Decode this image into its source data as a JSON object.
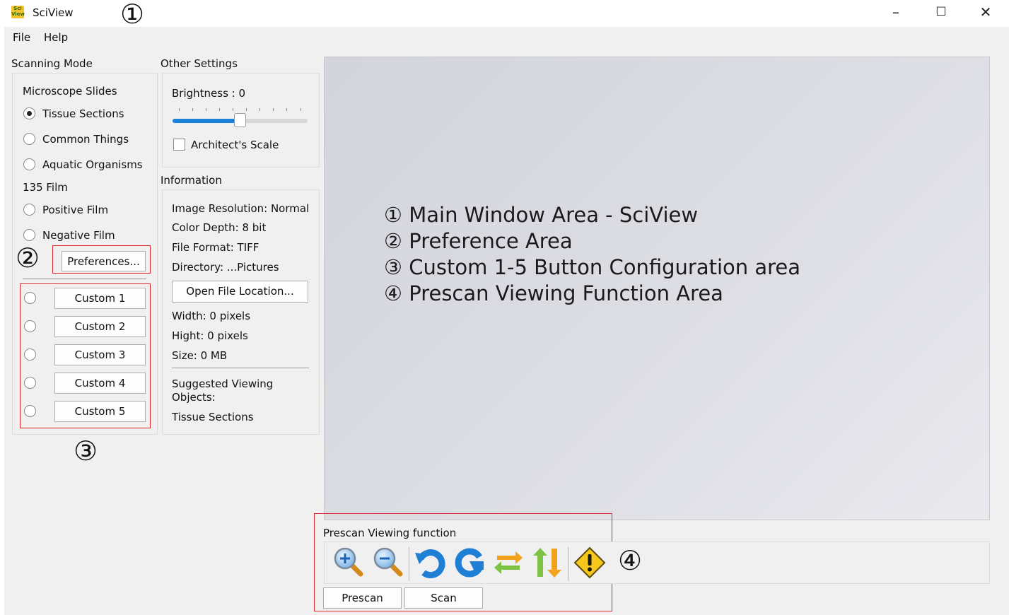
{
  "window": {
    "title": "SciView",
    "icon_text": "Sci\nView",
    "minimize": "–",
    "maximize": "☐",
    "close": "✕"
  },
  "menu": {
    "file": "File",
    "help": "Help"
  },
  "markers": {
    "m1": "①",
    "m2": "②",
    "m3": "③",
    "m4": "④"
  },
  "scanning_mode": {
    "title": "Scanning Mode",
    "microscope_label": "Microscope Slides",
    "tissue": "Tissue Sections",
    "common": "Common Things",
    "aquatic": "Aquatic Organisms",
    "film_label": "135 Film",
    "positive": "Positive Film",
    "negative": "Negative Film",
    "preferences": "Preferences...",
    "customs": [
      "Custom 1",
      "Custom 2",
      "Custom 3",
      "Custom 4",
      "Custom 5"
    ]
  },
  "other_settings": {
    "title": "Other Settings",
    "brightness": "Brightness : 0",
    "brightness_level": 0.5,
    "architect_scale": "Architect's Scale"
  },
  "information": {
    "title": "Information",
    "resolution": "Image Resolution: Normal",
    "color_depth": "Color Depth: 8 bit",
    "file_format": "File Format: TIFF",
    "directory": "Directory: ...Pictures",
    "open_location": "Open File Location...",
    "width": "Width: 0 pixels",
    "height": "Hight: 0 pixels",
    "size": "Size: 0 MB",
    "suggested_1": "Suggested Viewing",
    "suggested_2": "Objects:",
    "suggested_value": "Tissue Sections"
  },
  "notes": {
    "n1": "① Main Window Area - SciView",
    "n2": "② Preference Area",
    "n3": "③ Custom 1-5 Button Configuration area",
    "n4": "④ Prescan Viewing Function Area"
  },
  "prescan": {
    "title": "Prescan Viewing function",
    "tools": [
      "zoom-in-icon",
      "zoom-out-icon",
      "rotate-left-icon",
      "rotate-right-icon",
      "flip-horizontal-icon",
      "flip-vertical-icon",
      "warning-icon"
    ],
    "prescan_button": "Prescan",
    "scan_button": "Scan"
  },
  "colors": {
    "accent": "#1a7fd6",
    "highlight_box": "#e0262b"
  }
}
